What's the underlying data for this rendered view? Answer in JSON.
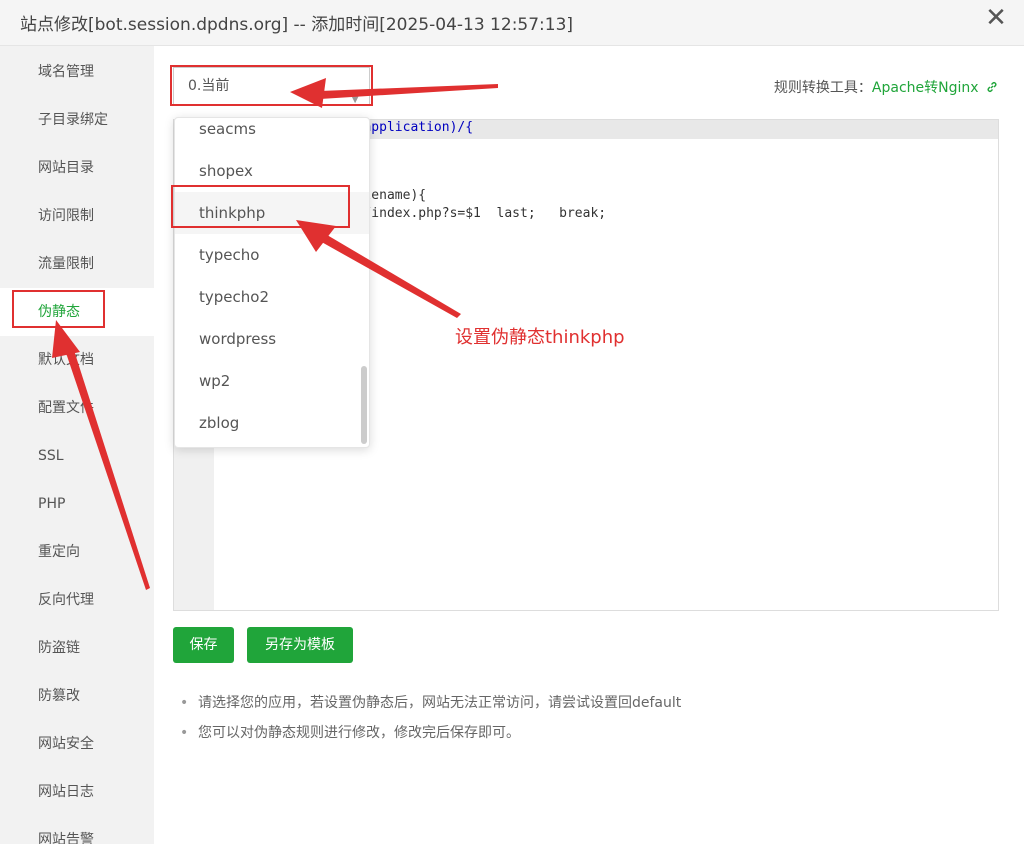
{
  "window": {
    "title": "站点修改[bot.session.dpdns.org] -- 添加时间[2025-04-13 12:57:13]",
    "close_glyph": "✕"
  },
  "sidebar": {
    "items": [
      {
        "label": "域名管理"
      },
      {
        "label": "子目录绑定"
      },
      {
        "label": "网站目录"
      },
      {
        "label": "访问限制"
      },
      {
        "label": "流量限制"
      },
      {
        "label": "伪静态",
        "active": true
      },
      {
        "label": "默认文档"
      },
      {
        "label": "配置文件"
      },
      {
        "label": "SSL"
      },
      {
        "label": "PHP"
      },
      {
        "label": "重定向"
      },
      {
        "label": "反向代理"
      },
      {
        "label": "防盗链"
      },
      {
        "label": "防篡改"
      },
      {
        "label": "网站安全"
      },
      {
        "label": "网站日志"
      },
      {
        "label": "网站告警"
      }
    ]
  },
  "rewrite": {
    "selected": "0.当前",
    "tool_label": "规则转换工具：",
    "tool_link": "Apache转Nginx",
    "tool_icon": "link-icon",
    "dropdown_options": [
      "seacms",
      "shopex",
      "thinkphp",
      "typecho",
      "typecho2",
      "wordpress",
      "wp2",
      "zblog"
    ],
    "highlighted_option": "thinkphp",
    "code_fragments": {
      "line1": "me|application)/{",
      "line4": "_filename){",
      "line5": "$  /index.php?s=$1  last;   break;"
    },
    "save_label": "保存",
    "save_as_template_label": "另存为模板",
    "tips": [
      "请选择您的应用，若设置伪静态后，网站无法正常访问，请尝试设置回default",
      "您可以对伪静态规则进行修改，修改完后保存即可。"
    ]
  },
  "annotation": {
    "text": "设置伪静态thinkphp",
    "color": "#e03030"
  },
  "colors": {
    "accent": "#20a53a",
    "annotation_red": "#e03030"
  }
}
